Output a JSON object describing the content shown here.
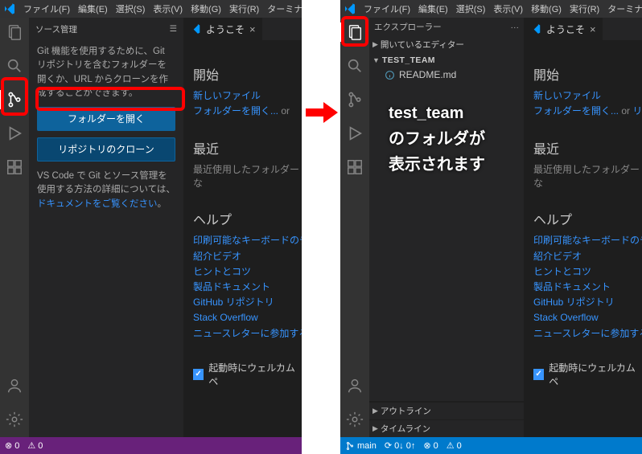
{
  "menu": {
    "items": [
      "ファイル(F)",
      "編集(E)",
      "選択(S)",
      "表示(V)",
      "移動(G)",
      "実行(R)",
      "ターミナル(T)"
    ]
  },
  "left": {
    "sidebar_title": "ソース管理",
    "scm_text": "Git 機能を使用するために、Git リポジトリを含むフォルダーを開くか、URL からクローンを作成することができます。",
    "btn_open": "フォルダーを開く",
    "btn_clone": "リポジトリのクローン",
    "scm_note_pre": "VS Code で Git とソース管理を使用する方法の詳細については、",
    "scm_note_link": "ドキュメントをご覧ください",
    "scm_note_post": "。"
  },
  "right": {
    "sidebar_title": "エクスプローラー",
    "open_editors": "開いているエディター",
    "folder": "TEST_TEAM",
    "file": "README.md",
    "outline": "アウトライン",
    "timeline": "タイムライン",
    "annotation_l1": "test_team",
    "annotation_l2": "のフォルダが",
    "annotation_l3": "表示されます",
    "status_branch": "main",
    "status_sync": "0↓ 0↑",
    "status_err": "0",
    "status_warn": "0"
  },
  "welcome": {
    "tab": "ようこそ",
    "start_h": "開始",
    "start_new": "新しいファイル",
    "start_open": "フォルダーを開く...",
    "start_or": " or ",
    "start_repo": "リポジ",
    "recent_h": "最近",
    "recent_none": "最近使用したフォルダーな",
    "help_h": "ヘルプ",
    "help_links": [
      "印刷可能なキーボードのチ",
      "紹介ビデオ",
      "ヒントとコツ",
      "製品ドキュメント",
      "GitHub リポジトリ",
      "Stack Overflow",
      "ニュースレターに参加する"
    ],
    "checkbox": "起動時にウェルカム ペ"
  },
  "status_left": {
    "err": "0",
    "warn": "0"
  }
}
